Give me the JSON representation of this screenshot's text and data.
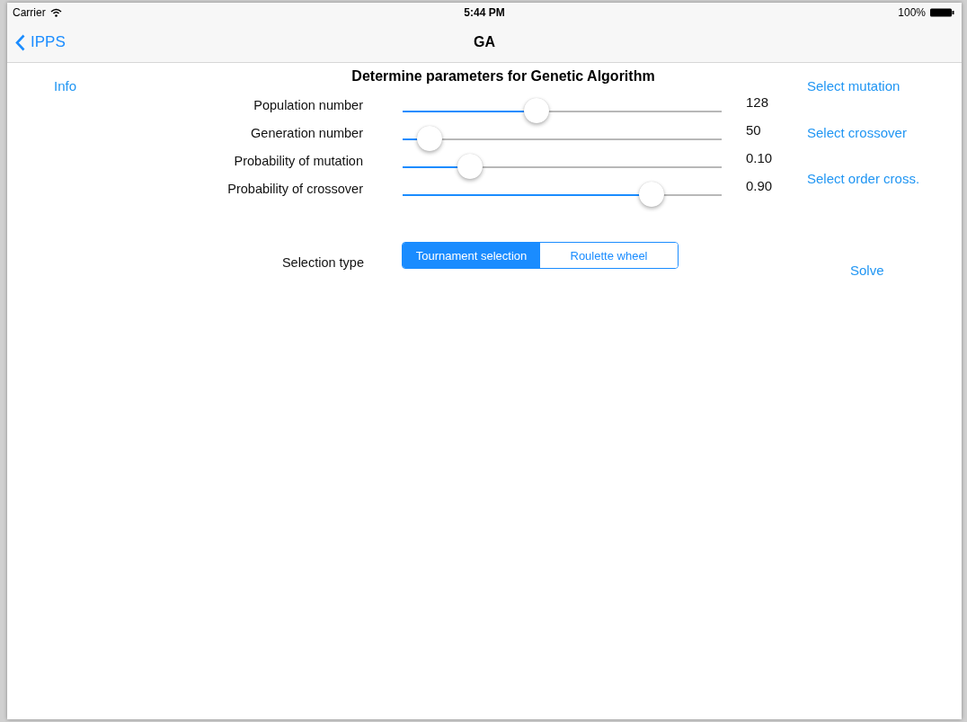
{
  "status_bar": {
    "carrier": "Carrier",
    "time": "5:44 PM",
    "battery": "100%"
  },
  "nav_bar": {
    "back": "IPPS",
    "title": "GA"
  },
  "info_button": "Info",
  "heading": "Determine parameters for Genetic Algorithm",
  "sliders": [
    {
      "label": "Population number",
      "level": 0.42,
      "reading": "128"
    },
    {
      "label": "Generation number",
      "level": 0.085,
      "reading": "50"
    },
    {
      "label": "Probability of mutation",
      "level": 0.21,
      "reading": "0.10"
    },
    {
      "label": "Probability of crossover",
      "level": 0.78,
      "reading": "0.90"
    }
  ],
  "selection": {
    "label": "Selection type",
    "segments": [
      {
        "label": "Tournament selection",
        "selected": true
      },
      {
        "label": "Roulette wheel",
        "selected": false
      }
    ]
  },
  "side_buttons": [
    "Select mutation",
    "Select crossover",
    "Select order cross."
  ],
  "solve_button": "Solve"
}
